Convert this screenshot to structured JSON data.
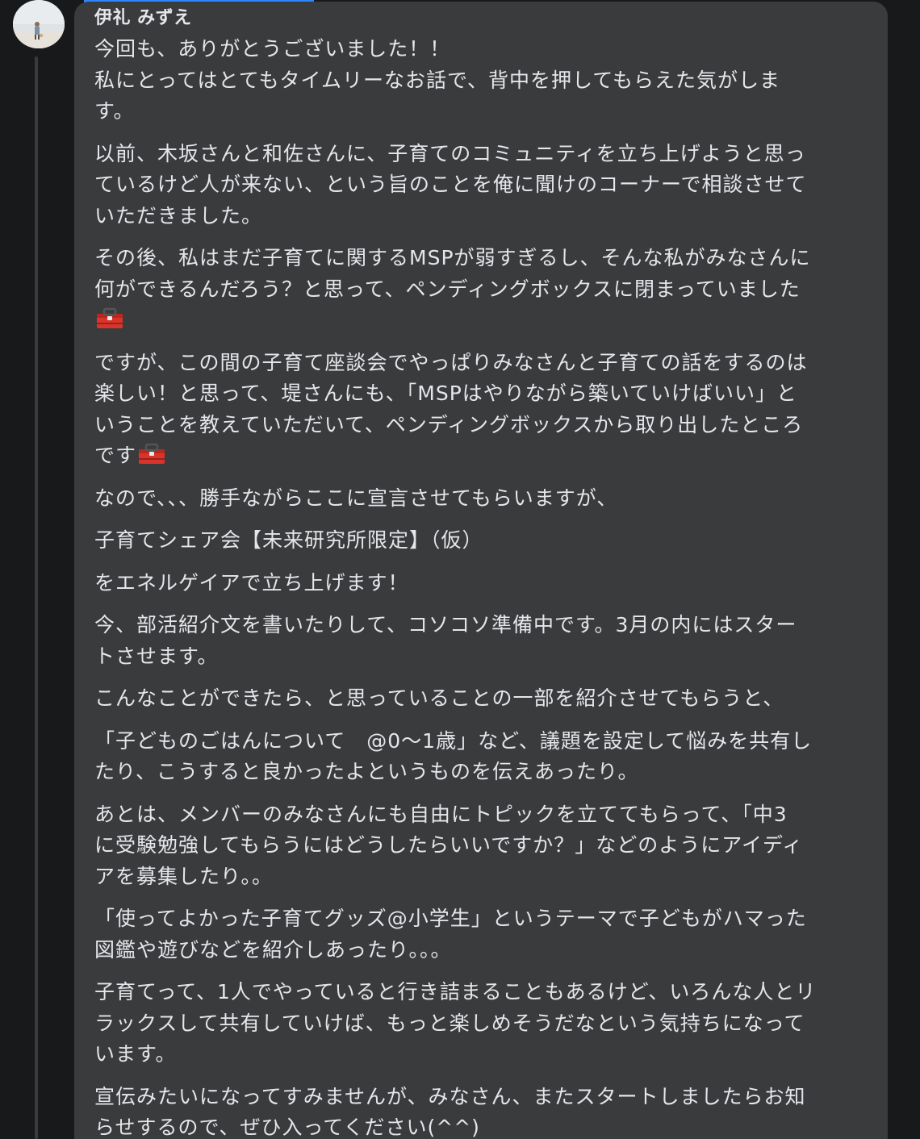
{
  "comment": {
    "author": "伊礼 みずえ",
    "paragraphs": [
      "今回も、ありがとうございました！！\n私にとってはとてもタイムリーなお話で、背中を押してもらえた気がしま\nす。",
      "以前、木坂さんと和佐さんに、子育てのコミュニティを立ち上げようと思っ\nているけど人が来ない、という旨のことを俺に聞けのコーナーで相談させて\nいただきました。",
      "その後、私はまだ子育てに関するMSPが弱すぎるし、そんな私がみなさんに\n何ができるんだろう？と思って、ペンディングボックスに閉まっていました\n",
      "ですが、この間の子育て座談会でやっぱりみなさんと子育ての話をするのは\n楽しい！と思って、堤さんにも、「MSPはやりながら築いていけばいい」と\nいうことを教えていただいて、ペンディングボックスから取り出したところ\nです",
      "なので、、、勝手ながらここに宣言させてもらいますが、",
      "子育てシェア会【未来研究所限定】（仮）",
      "をエネルゲイアで立ち上げます！",
      "今、部活紹介文を書いたりして、コソコソ準備中です。3月の内にはスター\nトさせます。",
      "こんなことができたら、と思っていることの一部を紹介させてもらうと、",
      "「子どものごはんについて　@0〜1歳」など、議題を設定して悩みを共有し\nたり、こうすると良かったよというものを伝えあったり。",
      "あとは、メンバーのみなさんにも自由にトピックを立ててもらって、「中3\nに受験勉強してもらうにはどうしたらいいですか？」などのようにアイディ\nアを募集したり。。",
      "「使ってよかった子育てグッズ@小学生」というテーマで子どもがハマった\n図鑑や遊びなどを紹介しあったり。。。",
      "子育てって、1人でやっていると行き詰まることもあるけど、いろんな人とリ\nラックスして共有していけば、もっと楽しめそうだなという気持ちになって\nいます。",
      "宣伝みたいになってすみませんが、みなさん、またスタートしましたらお知\nらせするので、ぜひ入ってください(^^)"
    ],
    "emoji": "toolbox-emoji"
  },
  "colors": {
    "background": "#18191a",
    "bubble": "#3a3b3c",
    "text": "#e4e6eb",
    "accent": "#2d88ff"
  }
}
